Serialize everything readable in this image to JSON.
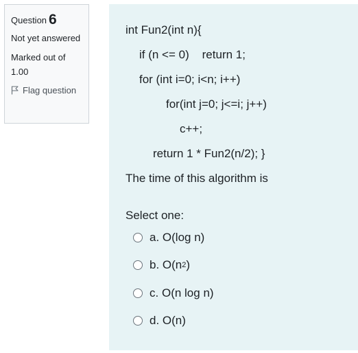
{
  "info": {
    "question_label": "Question",
    "question_number": "6",
    "state": "Not yet answered",
    "grade": "Marked out of 1.00",
    "flag_label": "Flag question"
  },
  "question": {
    "code_lines": [
      "int Fun2(int n){",
      "if (n <= 0)    return 1;",
      "for (int i=0; i<n; i++)",
      "for(int j=0; j<=i; j++)",
      "c++;",
      "return 1 * Fun2(n/2); }"
    ],
    "prompt": "The time of this algorithm is",
    "select_one": "Select one:"
  },
  "options": [
    {
      "letter": "a.",
      "text": "O(log n)"
    },
    {
      "letter": "b.",
      "text": "O(n",
      "sup": "2",
      "after": ")"
    },
    {
      "letter": "c.",
      "text": "O(n log n)"
    },
    {
      "letter": "d.",
      "text": "O(n)"
    }
  ]
}
